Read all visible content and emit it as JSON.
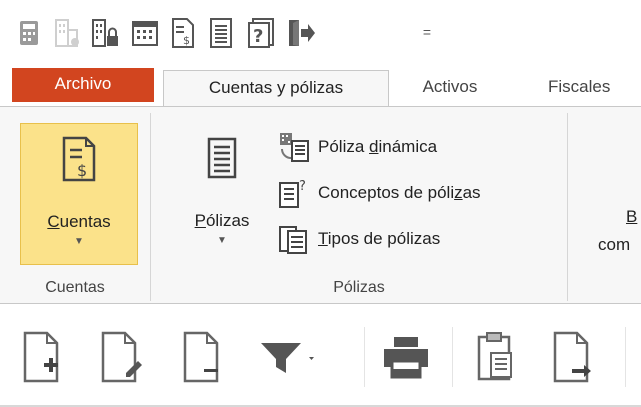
{
  "quick_access": {
    "icons": [
      "calculator-icon",
      "building-disabled-icon",
      "building-lock-icon",
      "calendar-icon",
      "document-dollar-icon",
      "document-list-icon",
      "help-document-icon",
      "exit-icon"
    ],
    "dropdown_glyph": "="
  },
  "tabs": [
    {
      "label": "Archivo",
      "active": false
    },
    {
      "label": "Cuentas y pólizas",
      "active": true
    },
    {
      "label": "Activos",
      "active": false
    },
    {
      "label": "Fiscales",
      "active": false
    }
  ],
  "ribbon": {
    "cuentas_group": {
      "button_label": "Cuentas",
      "group_label": "Cuentas"
    },
    "polizas_group": {
      "button_label": "Pólizas",
      "group_label": "Pólizas",
      "items": [
        {
          "label_pre": "Póliza ",
          "label_u": "d",
          "label_post": "inámica"
        },
        {
          "label_pre": "Conceptos de póli",
          "label_u": "z",
          "label_post": "as"
        },
        {
          "label_pre": "",
          "label_u": "T",
          "label_post": "ipos de pólizas"
        }
      ]
    },
    "partial_group": {
      "line1": "B",
      "line2": "com"
    }
  },
  "toolbar": {
    "icons": [
      "new-document-icon",
      "edit-document-icon",
      "remove-document-icon",
      "filter-icon",
      "print-icon",
      "clipboard-icon",
      "export-document-icon"
    ]
  },
  "colors": {
    "archivo_tab": "#d2451f",
    "selected_button": "#fbe28a",
    "ribbon_bg": "#f7f7f7"
  }
}
